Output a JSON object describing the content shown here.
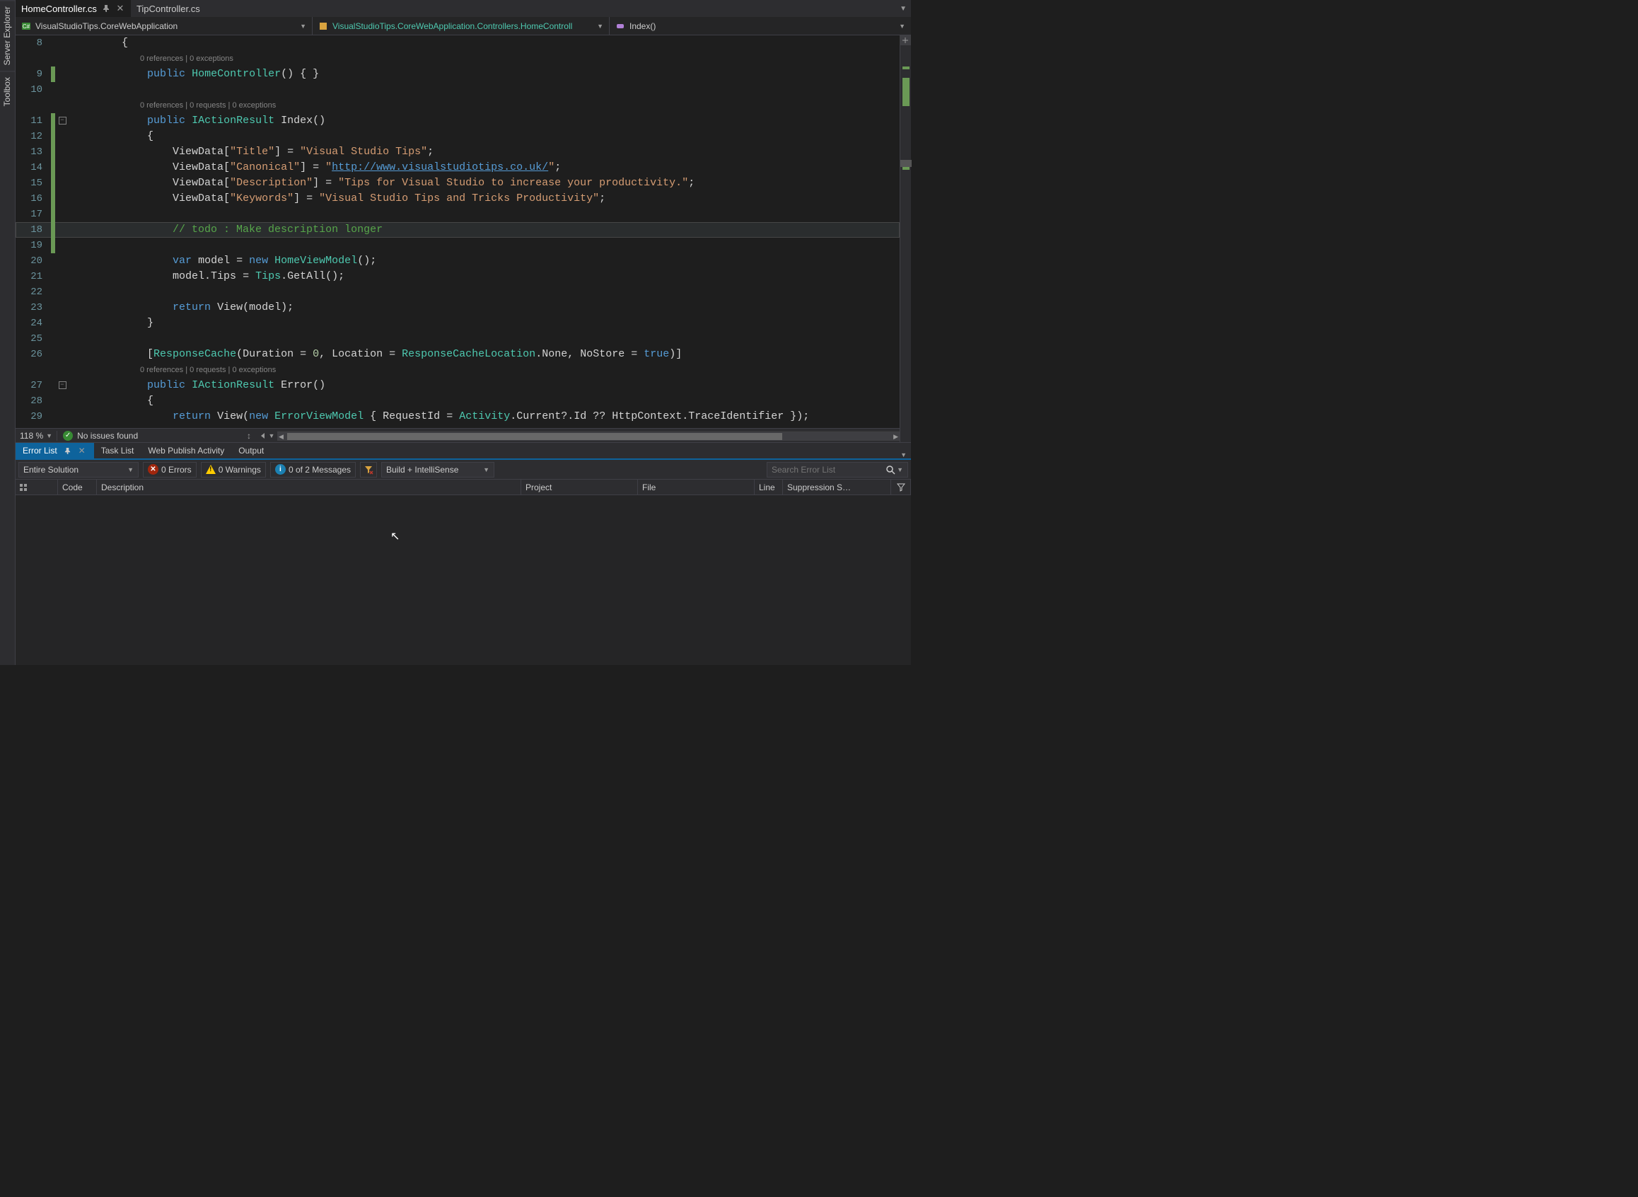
{
  "left_tools": {
    "server_explorer": "Server Explorer",
    "toolbox": "Toolbox"
  },
  "tabs": [
    {
      "label": "HomeController.cs",
      "active": true,
      "pinned": true
    },
    {
      "label": "TipController.cs",
      "active": false,
      "pinned": false
    }
  ],
  "navbar": {
    "scope": "VisualStudioTips.CoreWebApplication",
    "type": "VisualStudioTips.CoreWebApplication.Controllers.HomeControll",
    "member": "Index()"
  },
  "zoom": "118 %",
  "issues_text": "No issues found",
  "codelens": {
    "ctor": "0 references | 0 exceptions",
    "index": "0 references | 0 requests | 0 exceptions",
    "error": "0 references | 0 requests | 0 exceptions"
  },
  "code": {
    "l8": "{",
    "l9": "public HomeController() { }",
    "l10": "",
    "l11": "public IActionResult Index()",
    "l12": "{",
    "l13": "ViewData[\"Title\"] = \"Visual Studio Tips\";",
    "l14": "ViewData[\"Canonical\"] = \"http://www.visualstudiotips.co.uk/\";",
    "l15": "ViewData[\"Description\"] = \"Tips for Visual Studio to increase your productivity.\";",
    "l16": "ViewData[\"Keywords\"] = \"Visual Studio Tips and Tricks Productivity\";",
    "l17": "",
    "l18": "// todo : Make description longer",
    "l19": "",
    "l20": "var model = new HomeViewModel();",
    "l21": "model.Tips = Tips.GetAll();",
    "l22": "",
    "l23": "return View(model);",
    "l24": "}",
    "l25": "",
    "l26": "[ResponseCache(Duration = 0, Location = ResponseCacheLocation.None, NoStore = true)]",
    "l27": "public IActionResult Error()",
    "l28": "{",
    "l29": "return new ErrorViewModel { RequestId = Activity.Current?.Id ?? HttpContext.TraceIdentifier });"
  },
  "bottom_tabs": [
    {
      "label": "Error List",
      "active": true
    },
    {
      "label": "Task List",
      "active": false
    },
    {
      "label": "Web Publish Activity",
      "active": false
    },
    {
      "label": "Output",
      "active": false
    }
  ],
  "error_toolbar": {
    "scope": "Entire Solution",
    "errors": "0 Errors",
    "warnings": "0 Warnings",
    "messages": "0 of 2 Messages",
    "build_drop": "Build + IntelliSense",
    "search_placeholder": "Search Error List"
  },
  "error_columns": {
    "icon": "",
    "code": "Code",
    "description": "Description",
    "project": "Project",
    "file": "File",
    "line": "Line",
    "suppression": "Suppression S…"
  }
}
